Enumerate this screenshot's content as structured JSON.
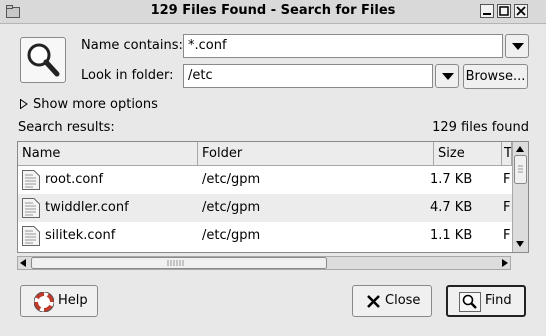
{
  "window": {
    "title": "129 Files Found - Search for Files",
    "controls": [
      "minimize",
      "maximize",
      "close"
    ]
  },
  "form": {
    "name_label": "Name contains:",
    "name_value": "*.conf",
    "folder_label": "Look in folder:",
    "folder_value": "/etc",
    "browse_label": "Browse...",
    "more_options_label": "Show more options"
  },
  "results": {
    "label": "Search results:",
    "count_text": "129 files found",
    "columns": [
      "Name",
      "Folder",
      "Size",
      "T"
    ],
    "rows": [
      {
        "name": "root.conf",
        "folder": "/etc/gpm",
        "size": "1.7 KB",
        "type": "F"
      },
      {
        "name": "twiddler.conf",
        "folder": "/etc/gpm",
        "size": "4.7 KB",
        "type": "F"
      },
      {
        "name": "silitek.conf",
        "folder": "/etc/gpm",
        "size": "1.1 KB",
        "type": "F"
      }
    ]
  },
  "buttons": {
    "help": "Help",
    "close": "Close",
    "find": "Find"
  },
  "icons": [
    "app-icon",
    "magnifier-icon",
    "expander-triangle-icon",
    "text-file-icon",
    "help-lifebuoy-icon",
    "close-x-icon",
    "find-icon"
  ]
}
